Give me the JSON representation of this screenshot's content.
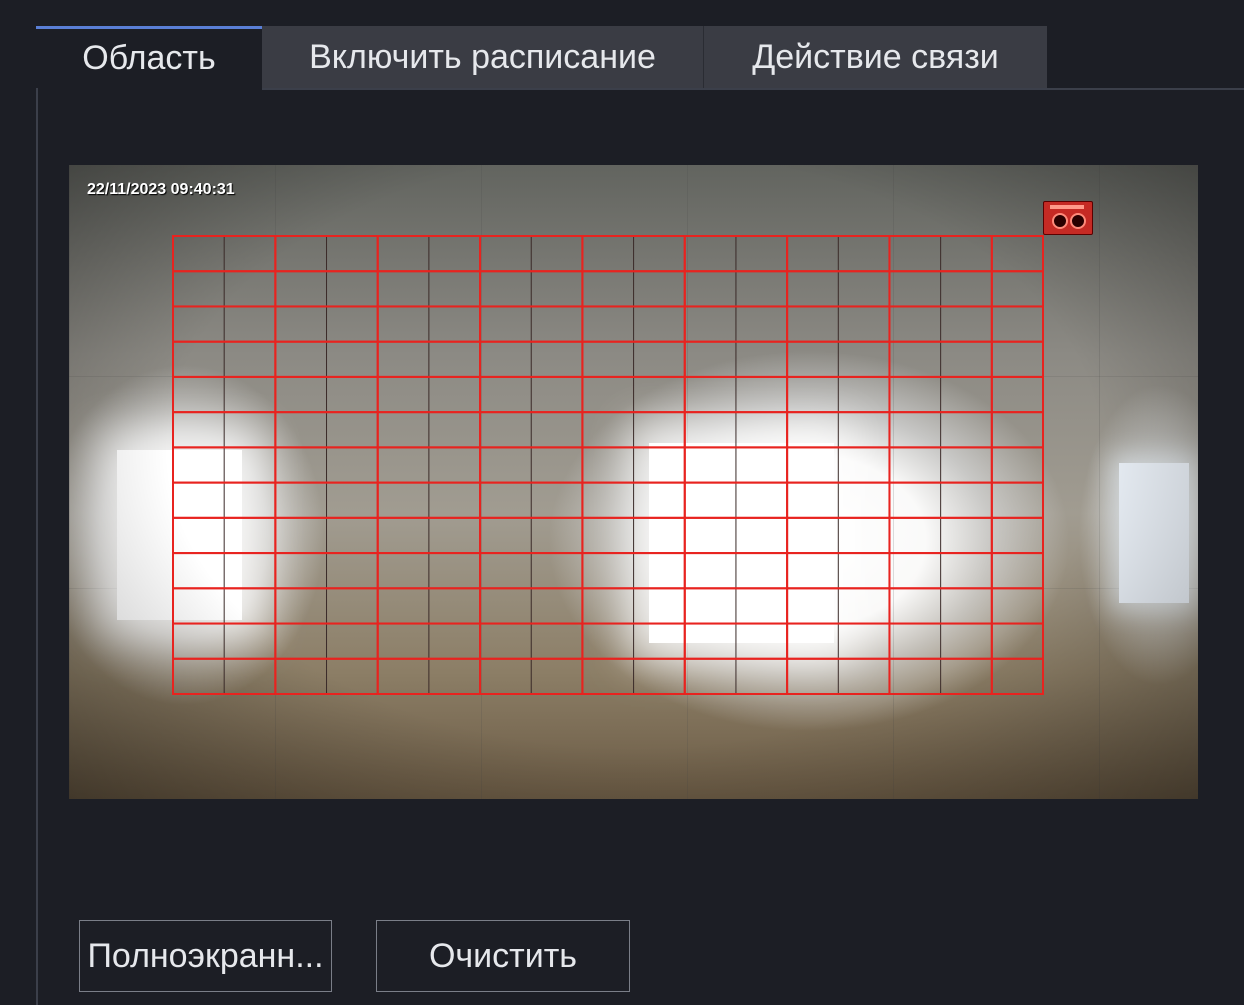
{
  "tabs": [
    {
      "label": "Область",
      "active": true
    },
    {
      "label": "Включить расписание",
      "active": false
    },
    {
      "label": "Действие связи",
      "active": false
    }
  ],
  "video": {
    "timestamp": "22/11/2023  09:40:31",
    "recording_icon": "recording-indicator-icon"
  },
  "motion_grid": {
    "columns": 17,
    "rows": 13,
    "all_cells_selected": true,
    "line_color": "#e8231f",
    "faint_line_color": "#3a2a28"
  },
  "buttons": {
    "fullscreen_label": "Полноэкранн...",
    "clear_label": "Очистить"
  },
  "colors": {
    "background": "#1c1e25",
    "active_tab_accent": "#5a7fd6",
    "inactive_tab": "#3a3c44",
    "text": "#e6e8ec"
  }
}
